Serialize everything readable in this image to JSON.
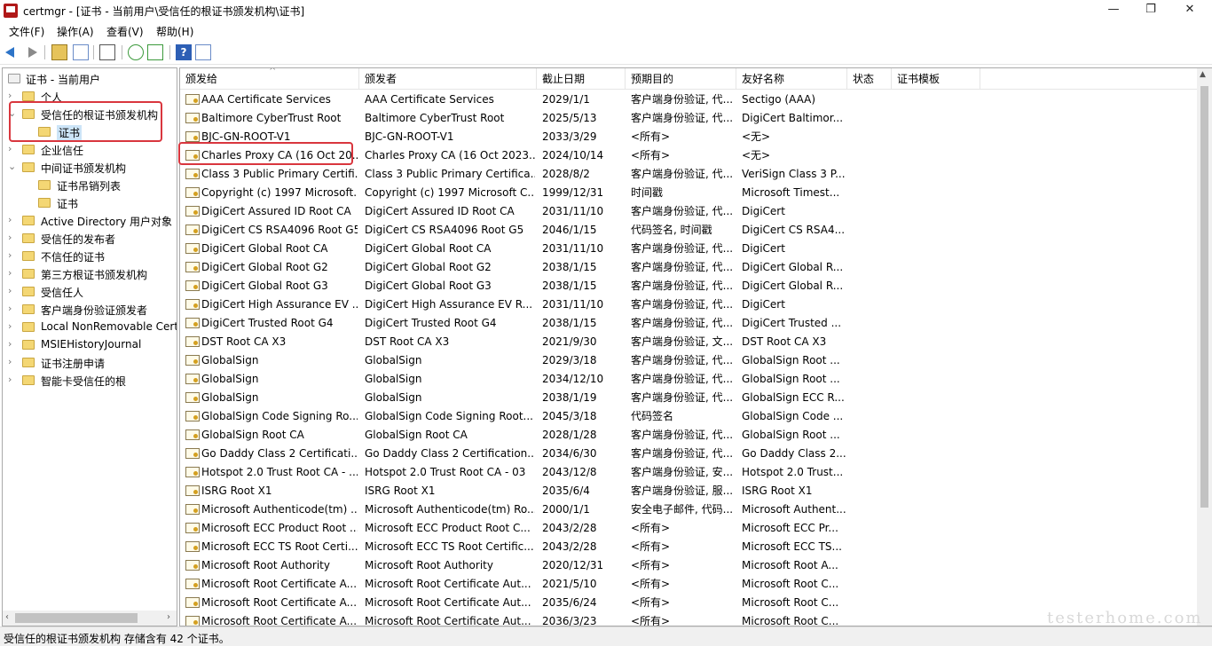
{
  "window": {
    "title": "certmgr - [证书 - 当前用户\\受信任的根证书颁发机构\\证书]",
    "minimize": "—",
    "maximize": "❐",
    "close": "✕"
  },
  "menu": [
    "文件(F)",
    "操作(A)",
    "查看(V)",
    "帮助(H)"
  ],
  "toolbar": {
    "help": "?"
  },
  "tree": {
    "root": "证书 - 当前用户",
    "items": [
      {
        "label": "个人",
        "expanded": false
      },
      {
        "label": "受信任的根证书颁发机构",
        "expanded": true
      },
      {
        "label": "证书",
        "child": true,
        "selected": true
      },
      {
        "label": "企业信任",
        "expanded": false
      },
      {
        "label": "中间证书颁发机构",
        "expanded": true
      },
      {
        "label": "证书吊销列表",
        "child": true
      },
      {
        "label": "证书",
        "child": true
      },
      {
        "label": "Active Directory 用户对象",
        "expanded": false
      },
      {
        "label": "受信任的发布者",
        "expanded": false
      },
      {
        "label": "不信任的证书",
        "expanded": false
      },
      {
        "label": "第三方根证书颁发机构",
        "expanded": false
      },
      {
        "label": "受信任人",
        "expanded": false
      },
      {
        "label": "客户端身份验证颁发者",
        "expanded": false
      },
      {
        "label": "Local NonRemovable Certificates",
        "expanded": false
      },
      {
        "label": "MSIEHistoryJournal",
        "expanded": false
      },
      {
        "label": "证书注册申请",
        "expanded": false
      },
      {
        "label": "智能卡受信任的根",
        "expanded": false
      }
    ]
  },
  "columns": [
    "颁发给",
    "颁发者",
    "截止日期",
    "预期目的",
    "友好名称",
    "状态",
    "证书模板"
  ],
  "rows": [
    [
      "AAA Certificate Services",
      "AAA Certificate Services",
      "2029/1/1",
      "客户端身份验证, 代...",
      "Sectigo (AAA)"
    ],
    [
      "Baltimore CyberTrust Root",
      "Baltimore CyberTrust Root",
      "2025/5/13",
      "客户端身份验证, 代...",
      "DigiCert Baltimor..."
    ],
    [
      "BJC-GN-ROOT-V1",
      "BJC-GN-ROOT-V1",
      "2033/3/29",
      "<所有>",
      "<无>"
    ],
    [
      "Charles Proxy CA (16 Oct 20...",
      "Charles Proxy CA (16 Oct 2023...",
      "2024/10/14",
      "<所有>",
      "<无>"
    ],
    [
      "Class 3 Public Primary Certifi...",
      "Class 3 Public Primary Certifica...",
      "2028/8/2",
      "客户端身份验证, 代...",
      "VeriSign Class 3 P..."
    ],
    [
      "Copyright (c) 1997 Microsoft...",
      "Copyright (c) 1997 Microsoft C...",
      "1999/12/31",
      "时间戳",
      "Microsoft Timest..."
    ],
    [
      "DigiCert Assured ID Root CA",
      "DigiCert Assured ID Root CA",
      "2031/11/10",
      "客户端身份验证, 代...",
      "DigiCert"
    ],
    [
      "DigiCert CS RSA4096 Root G5",
      "DigiCert CS RSA4096 Root G5",
      "2046/1/15",
      "代码签名, 时间戳",
      "DigiCert CS RSA4..."
    ],
    [
      "DigiCert Global Root CA",
      "DigiCert Global Root CA",
      "2031/11/10",
      "客户端身份验证, 代...",
      "DigiCert"
    ],
    [
      "DigiCert Global Root G2",
      "DigiCert Global Root G2",
      "2038/1/15",
      "客户端身份验证, 代...",
      "DigiCert Global R..."
    ],
    [
      "DigiCert Global Root G3",
      "DigiCert Global Root G3",
      "2038/1/15",
      "客户端身份验证, 代...",
      "DigiCert Global R..."
    ],
    [
      "DigiCert High Assurance EV ...",
      "DigiCert High Assurance EV R...",
      "2031/11/10",
      "客户端身份验证, 代...",
      "DigiCert"
    ],
    [
      "DigiCert Trusted Root G4",
      "DigiCert Trusted Root G4",
      "2038/1/15",
      "客户端身份验证, 代...",
      "DigiCert Trusted ..."
    ],
    [
      "DST Root CA X3",
      "DST Root CA X3",
      "2021/9/30",
      "客户端身份验证, 文...",
      "DST Root CA X3"
    ],
    [
      "GlobalSign",
      "GlobalSign",
      "2029/3/18",
      "客户端身份验证, 代...",
      "GlobalSign Root ..."
    ],
    [
      "GlobalSign",
      "GlobalSign",
      "2034/12/10",
      "客户端身份验证, 代...",
      "GlobalSign Root ..."
    ],
    [
      "GlobalSign",
      "GlobalSign",
      "2038/1/19",
      "客户端身份验证, 代...",
      "GlobalSign ECC R..."
    ],
    [
      "GlobalSign Code Signing Ro...",
      "GlobalSign Code Signing Root...",
      "2045/3/18",
      "代码签名",
      "GlobalSign Code ..."
    ],
    [
      "GlobalSign Root CA",
      "GlobalSign Root CA",
      "2028/1/28",
      "客户端身份验证, 代...",
      "GlobalSign Root ..."
    ],
    [
      "Go Daddy Class 2 Certificati...",
      "Go Daddy Class 2 Certification...",
      "2034/6/30",
      "客户端身份验证, 代...",
      "Go Daddy Class 2..."
    ],
    [
      "Hotspot 2.0 Trust Root CA - ...",
      "Hotspot 2.0 Trust Root CA - 03",
      "2043/12/8",
      "客户端身份验证, 安...",
      "Hotspot 2.0 Trust..."
    ],
    [
      "ISRG Root X1",
      "ISRG Root X1",
      "2035/6/4",
      "客户端身份验证, 服...",
      "ISRG Root X1"
    ],
    [
      "Microsoft Authenticode(tm) ...",
      "Microsoft Authenticode(tm) Ro...",
      "2000/1/1",
      "安全电子邮件, 代码...",
      "Microsoft Authent..."
    ],
    [
      "Microsoft ECC Product Root ...",
      "Microsoft ECC Product Root C...",
      "2043/2/28",
      "<所有>",
      "Microsoft ECC Pr..."
    ],
    [
      "Microsoft ECC TS Root Certi...",
      "Microsoft ECC TS Root Certific...",
      "2043/2/28",
      "<所有>",
      "Microsoft ECC TS..."
    ],
    [
      "Microsoft Root Authority",
      "Microsoft Root Authority",
      "2020/12/31",
      "<所有>",
      "Microsoft Root A..."
    ],
    [
      "Microsoft Root Certificate A...",
      "Microsoft Root Certificate Aut...",
      "2021/5/10",
      "<所有>",
      "Microsoft Root C..."
    ],
    [
      "Microsoft Root Certificate A...",
      "Microsoft Root Certificate Aut...",
      "2035/6/24",
      "<所有>",
      "Microsoft Root C..."
    ],
    [
      "Microsoft Root Certificate A...",
      "Microsoft Root Certificate Aut...",
      "2036/3/23",
      "<所有>",
      "Microsoft Root C..."
    ]
  ],
  "status": "受信任的根证书颁发机构 存储含有 42 个证书。",
  "watermark": "testerhome.com",
  "colors": {
    "highlight": "#d9363e",
    "selection": "#cce4f7"
  }
}
